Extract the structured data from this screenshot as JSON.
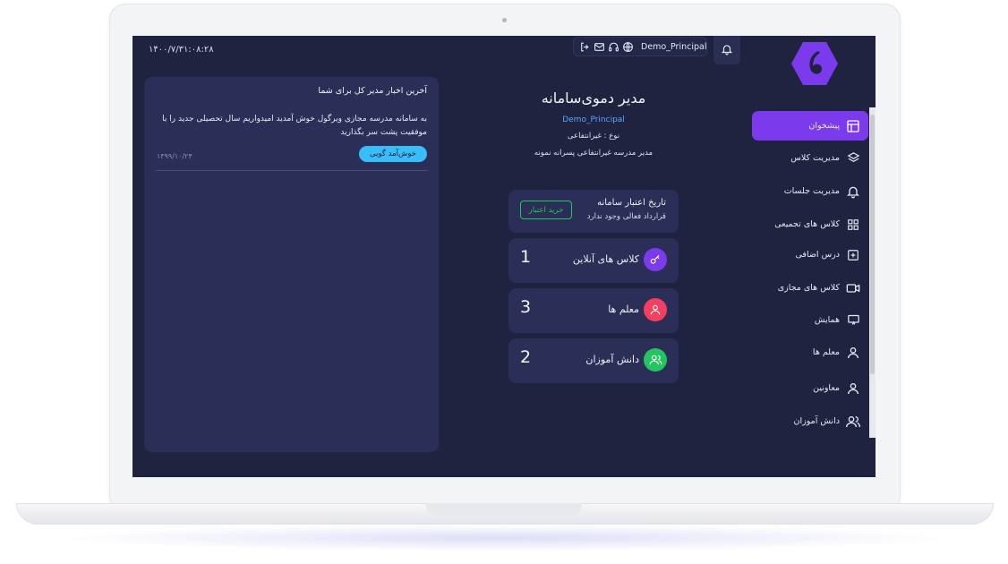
{
  "header": {
    "datetime": "۱۴۰۰/۷/۳۱:۰۸:۲۸",
    "username": "Demo_Principal",
    "icons": [
      "logout-icon",
      "mail-icon",
      "headset-icon",
      "globe-icon"
    ],
    "bell_icon": "bell-icon"
  },
  "sidebar": {
    "items": [
      {
        "label": "پیشخوان",
        "icon": "dashboard-icon",
        "active": true
      },
      {
        "label": "مدیریت کلاس",
        "icon": "layers-icon"
      },
      {
        "label": "مدیریت جلسات",
        "icon": "bell-icon"
      },
      {
        "label": "کلاس های تجمیعی",
        "icon": "grid-icon"
      },
      {
        "label": "درس اضافی",
        "icon": "plus-square-icon"
      },
      {
        "label": "کلاس های مجازی",
        "icon": "video-icon"
      },
      {
        "label": "همایش",
        "icon": "presentation-icon"
      },
      {
        "label": "معلم ها",
        "icon": "user-icon"
      },
      {
        "label": "معاونین",
        "icon": "user-icon"
      },
      {
        "label": "دانش آموزان",
        "icon": "users-icon"
      }
    ]
  },
  "profile": {
    "name": "مدیر دموی‌سامانه",
    "username": "Demo_Principal",
    "type": "نوع : غیرانتفاعی",
    "role": "مدیر مدرسه غیرانتفاعی پسرانه نمونه"
  },
  "credit": {
    "title": "تاریخ اعتبار سامانه",
    "subtitle": "قرارداد فعالی وجود ندارد",
    "buy_label": "خرید اعتبار"
  },
  "stats": [
    {
      "label": "کلاس های آنلاین",
      "value": "1",
      "color": "#7c3aed",
      "icon": "key-icon"
    },
    {
      "label": "معلم ها",
      "value": "3",
      "color": "#f43f5e",
      "icon": "user-icon"
    },
    {
      "label": "دانش آموزان",
      "value": "2",
      "color": "#22c55e",
      "icon": "users-icon"
    }
  ],
  "news": {
    "title": "آخرین اخبار مدیر کل برای شما",
    "body": "به سامانه مدرسه مجازی ویرگول خوش آمدید امیدواریم سال تحصیلی جدید را با موفقیت پشت سر بگذارید",
    "greet_label": "خوش‌آمد گویی",
    "date": "۱۳۹۹/۱۰/۲۴"
  },
  "colors": {
    "background": "#202340",
    "card": "#2b2f57",
    "accent": "#7c3aed",
    "link": "#5aa6ff",
    "success": "#22c55e",
    "info": "#38bdf8"
  }
}
